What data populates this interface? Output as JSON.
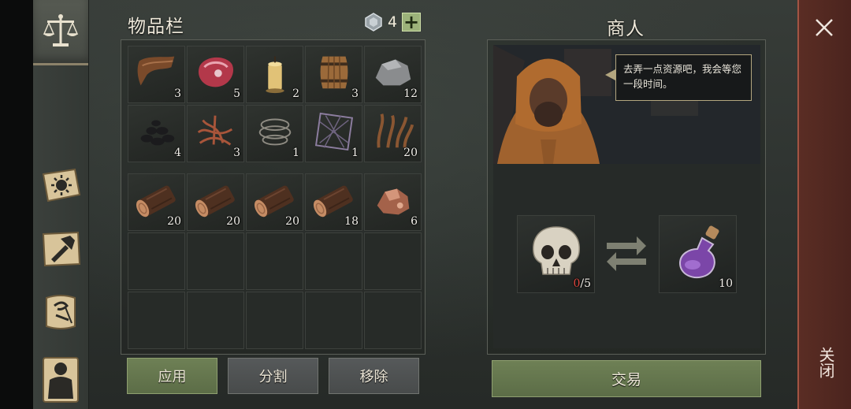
{
  "inventory": {
    "title": "物品栏",
    "currency": {
      "icon": "silver-gem-icon",
      "value": "4",
      "add_label": "+"
    },
    "rows": [
      [
        {
          "icon": "leather-icon",
          "count": "3"
        },
        {
          "icon": "raw-meat-icon",
          "count": "5"
        },
        {
          "icon": "candle-icon",
          "count": "2"
        },
        {
          "icon": "barrel-icon",
          "count": "3"
        },
        {
          "icon": "stone-icon",
          "count": "12"
        }
      ],
      [
        {
          "icon": "coal-icon",
          "count": "4"
        },
        {
          "icon": "roots-icon",
          "count": "3"
        },
        {
          "icon": "rope-icon",
          "count": "1"
        },
        {
          "icon": "net-icon",
          "count": "1"
        },
        {
          "icon": "fiber-icon",
          "count": "20"
        }
      ],
      [
        {
          "icon": "log-icon",
          "count": "20"
        },
        {
          "icon": "log-icon",
          "count": "20"
        },
        {
          "icon": "log-icon",
          "count": "20"
        },
        {
          "icon": "log-icon",
          "count": "18"
        },
        {
          "icon": "copper-ore-icon",
          "count": "6"
        }
      ]
    ],
    "buttons": {
      "apply": "应用",
      "split": "分割",
      "remove": "移除"
    }
  },
  "merchant": {
    "title": "商人",
    "speech": "去弄一点资源吧，我会等您一段时间。",
    "trade": {
      "give": {
        "icon": "skull-icon",
        "have": "0",
        "need": "/5"
      },
      "receive": {
        "icon": "purple-potion-icon",
        "count": "10"
      }
    },
    "trade_button": "交易"
  },
  "close": {
    "label": "关闭"
  },
  "sidebar": {
    "items": [
      "scales-icon",
      "sun-scroll-icon",
      "crafting-hammer-icon",
      "quest-scroll-icon",
      "character-icon"
    ]
  },
  "colors": {
    "accent_green": "#6e8055",
    "close_red": "#5a2d24",
    "required_red": "#e0473f"
  }
}
